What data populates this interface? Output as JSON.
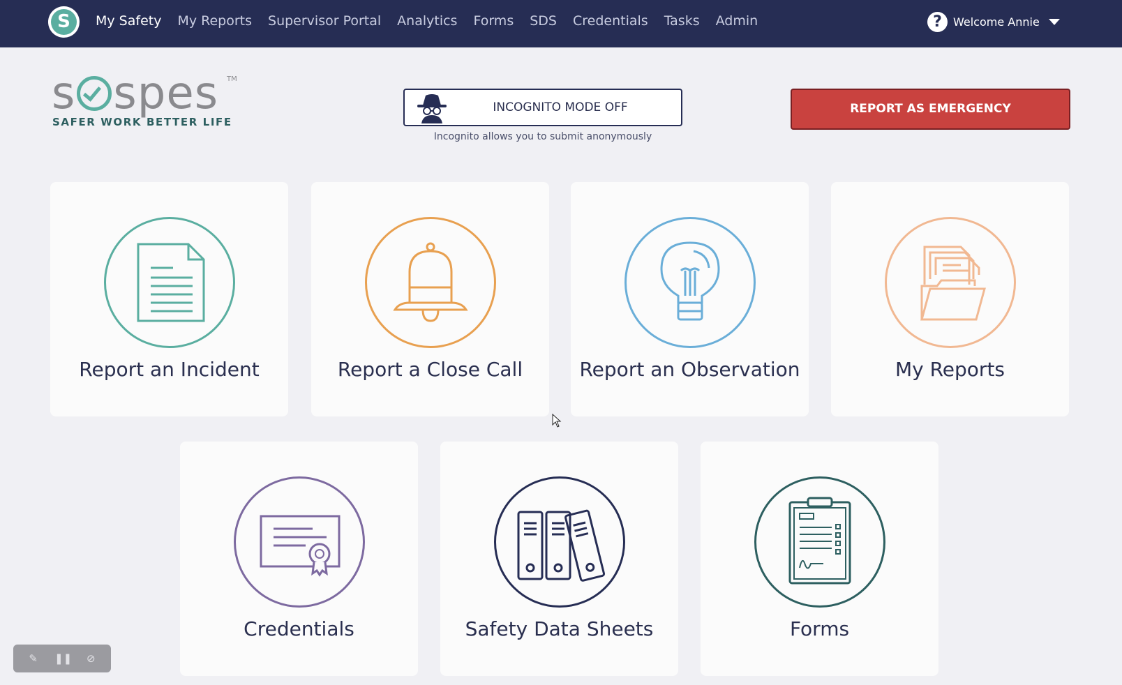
{
  "brand": {
    "logo_letter": "S"
  },
  "nav": {
    "items": [
      "My Safety",
      "My Reports",
      "Supervisor Portal",
      "Analytics",
      "Forms",
      "SDS",
      "Credentials",
      "Tasks",
      "Admin"
    ],
    "active": "My Safety"
  },
  "user": {
    "help_glyph": "?",
    "welcome": "Welcome Annie"
  },
  "logo": {
    "wordmark_start": "s",
    "wordmark_end": "spes",
    "tm": "TM",
    "tagline": "SAFER WORK  BETTER LIFE"
  },
  "incognito": {
    "label": "INCOGNITO MODE OFF",
    "note": "Incognito allows you to submit anonymously",
    "icon": "spy-icon"
  },
  "emergency": {
    "label": "REPORT AS EMERGENCY",
    "color": "#c9423f"
  },
  "cards": [
    {
      "label": "Report an Incident",
      "icon": "document-icon",
      "color": "#5aaea0"
    },
    {
      "label": "Report a Close Call",
      "icon": "bell-icon",
      "color": "#e8a050"
    },
    {
      "label": "Report an Observation",
      "icon": "lightbulb-icon",
      "color": "#6aaed8"
    },
    {
      "label": "My Reports",
      "icon": "folder-icon",
      "color": "#f1b892"
    },
    {
      "label": "Credentials",
      "icon": "certificate-icon",
      "color": "#7d6aa0"
    },
    {
      "label": "Safety Data Sheets",
      "icon": "binders-icon",
      "color": "#262d54"
    },
    {
      "label": "Forms",
      "icon": "clipboard-icon",
      "color": "#2d5f60"
    }
  ],
  "recorder": {
    "edit_icon": "✎",
    "pause_icon": "❚❚",
    "hide_icon": "⊘"
  },
  "theme": {
    "nav_bg": "#262d54",
    "page_bg": "#f0f0f4"
  }
}
